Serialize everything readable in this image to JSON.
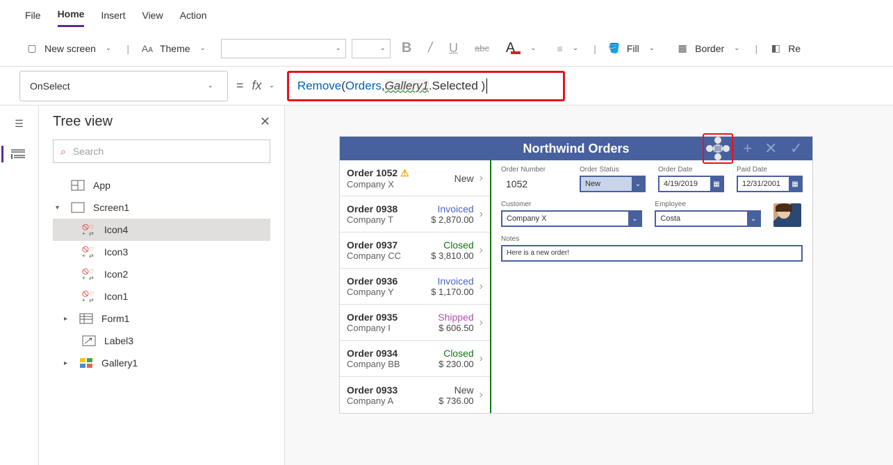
{
  "menu": {
    "file": "File",
    "home": "Home",
    "insert": "Insert",
    "view": "View",
    "action": "Action"
  },
  "ribbon": {
    "newScreen": "New screen",
    "theme": "Theme",
    "fill": "Fill",
    "border": "Border",
    "reorder": "Re"
  },
  "property": "OnSelect",
  "eq": "=",
  "fx": "fx",
  "formula": {
    "fn": "Remove",
    "open": "( ",
    "a1": "Orders",
    "comma": ", ",
    "obj": "Gallery1",
    "tail": ".Selected )"
  },
  "pane": {
    "title": "Tree view",
    "searchPlaceholder": "Search",
    "nodes": {
      "app": "App",
      "screen1": "Screen1",
      "icon4": "Icon4",
      "icon3": "Icon3",
      "icon2": "Icon2",
      "icon1": "Icon1",
      "form1": "Form1",
      "label3": "Label3",
      "gallery1": "Gallery1"
    }
  },
  "app": {
    "title": "Northwind Orders",
    "gallery": [
      {
        "ord": "Order 1052",
        "co": "Company X",
        "stat": "New",
        "amt": "",
        "cls": "st-new",
        "warn": true
      },
      {
        "ord": "Order 0938",
        "co": "Company T",
        "stat": "Invoiced",
        "amt": "$ 2,870.00",
        "cls": "st-invoiced",
        "warn": false
      },
      {
        "ord": "Order 0937",
        "co": "Company CC",
        "stat": "Closed",
        "amt": "$ 3,810.00",
        "cls": "st-closed",
        "warn": false
      },
      {
        "ord": "Order 0936",
        "co": "Company Y",
        "stat": "Invoiced",
        "amt": "$ 1,170.00",
        "cls": "st-invoiced",
        "warn": false
      },
      {
        "ord": "Order 0935",
        "co": "Company I",
        "stat": "Shipped",
        "amt": "$ 606.50",
        "cls": "st-shipped",
        "warn": false
      },
      {
        "ord": "Order 0934",
        "co": "Company BB",
        "stat": "Closed",
        "amt": "$ 230.00",
        "cls": "st-closed",
        "warn": false
      },
      {
        "ord": "Order 0933",
        "co": "Company A",
        "stat": "New",
        "amt": "$ 736.00",
        "cls": "st-new",
        "warn": false
      }
    ],
    "form": {
      "orderNumber": {
        "label": "Order Number",
        "value": "1052"
      },
      "orderStatus": {
        "label": "Order Status",
        "value": "New"
      },
      "orderDate": {
        "label": "Order Date",
        "value": "4/19/2019"
      },
      "paidDate": {
        "label": "Paid Date",
        "value": "12/31/2001"
      },
      "customer": {
        "label": "Customer",
        "value": "Company X"
      },
      "employee": {
        "label": "Employee",
        "value": "Costa"
      },
      "notes": {
        "label": "Notes",
        "value": "Here is a new order!"
      }
    }
  }
}
